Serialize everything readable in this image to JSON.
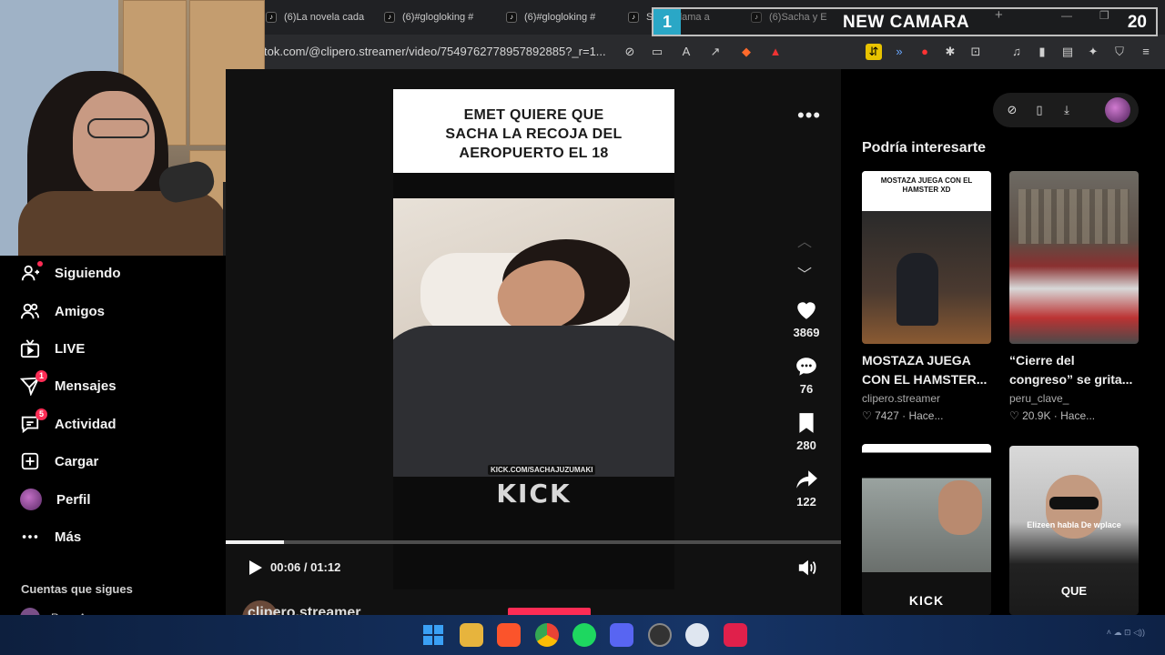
{
  "tabs": [
    {
      "label": "(6)La novela cada"
    },
    {
      "label": "(6)#glogloking #"
    },
    {
      "label": "(6)#glogloking #"
    },
    {
      "label": "Sacha llama a"
    },
    {
      "label": "(6)Sacha y E"
    }
  ],
  "address": {
    "url": "tok.com/@clipero.streamer/video/7549762778957892885?_r=1..."
  },
  "overlay": {
    "number": "1",
    "title": "NEW CAMARA",
    "count": "20"
  },
  "sidebar": {
    "items": [
      {
        "label": "Siguiendo",
        "icon": "following-icon"
      },
      {
        "label": "Amigos",
        "icon": "friends-icon"
      },
      {
        "label": "LIVE",
        "icon": "live-icon"
      },
      {
        "label": "Mensajes",
        "icon": "messages-icon",
        "badge": "1"
      },
      {
        "label": "Actividad",
        "icon": "activity-icon",
        "badge": "5"
      },
      {
        "label": "Cargar",
        "icon": "upload-icon"
      },
      {
        "label": "Perfil",
        "icon": "avatar"
      },
      {
        "label": "Más",
        "icon": "more-icon"
      }
    ],
    "following_title": "Cuentas que sigues",
    "following_user": "Ryan A"
  },
  "video": {
    "caption_lines": [
      "EMET QUIERE QUE",
      "SACHA LA RECOJA DEL",
      "AEROPUERTO EL 18"
    ],
    "kick_url": "KICK.COM/SACHAJUZUMAKI",
    "kick_logo": "KICK",
    "likes": "3869",
    "comments": "76",
    "saves": "280",
    "shares": "122",
    "time": "00:06 / 01:12",
    "progress": 0.094,
    "author": "clipero.streamer"
  },
  "recommended": {
    "title": "Podría interesarte",
    "cards": [
      {
        "thumb_text": "MOSTAZA JUEGA CON EL HAMSTER XD",
        "title_line1": "MOSTAZA JUEGA",
        "title_line2": "CON EL HAMSTER...",
        "author": "clipero.streamer",
        "stats": "♡ 7427 · Hace..."
      },
      {
        "thumb_text": "",
        "title_line1": "“Cierre del",
        "title_line2": "congreso” se grita...",
        "author": "peru_clave_",
        "stats": "♡ 20.9K · Hace..."
      },
      {
        "thumb_text": "KICK",
        "title_line1": "",
        "title_line2": "",
        "author": "",
        "stats": ""
      },
      {
        "thumb_text": "Elizeen habla De wplace",
        "thumb_text2": "QUE",
        "title_line1": "",
        "title_line2": "",
        "author": "",
        "stats": ""
      }
    ]
  },
  "colors": {
    "accent": "#fe2c55",
    "overlay_badge": "#2aa7c6",
    "taskbar": "#132e5b"
  }
}
